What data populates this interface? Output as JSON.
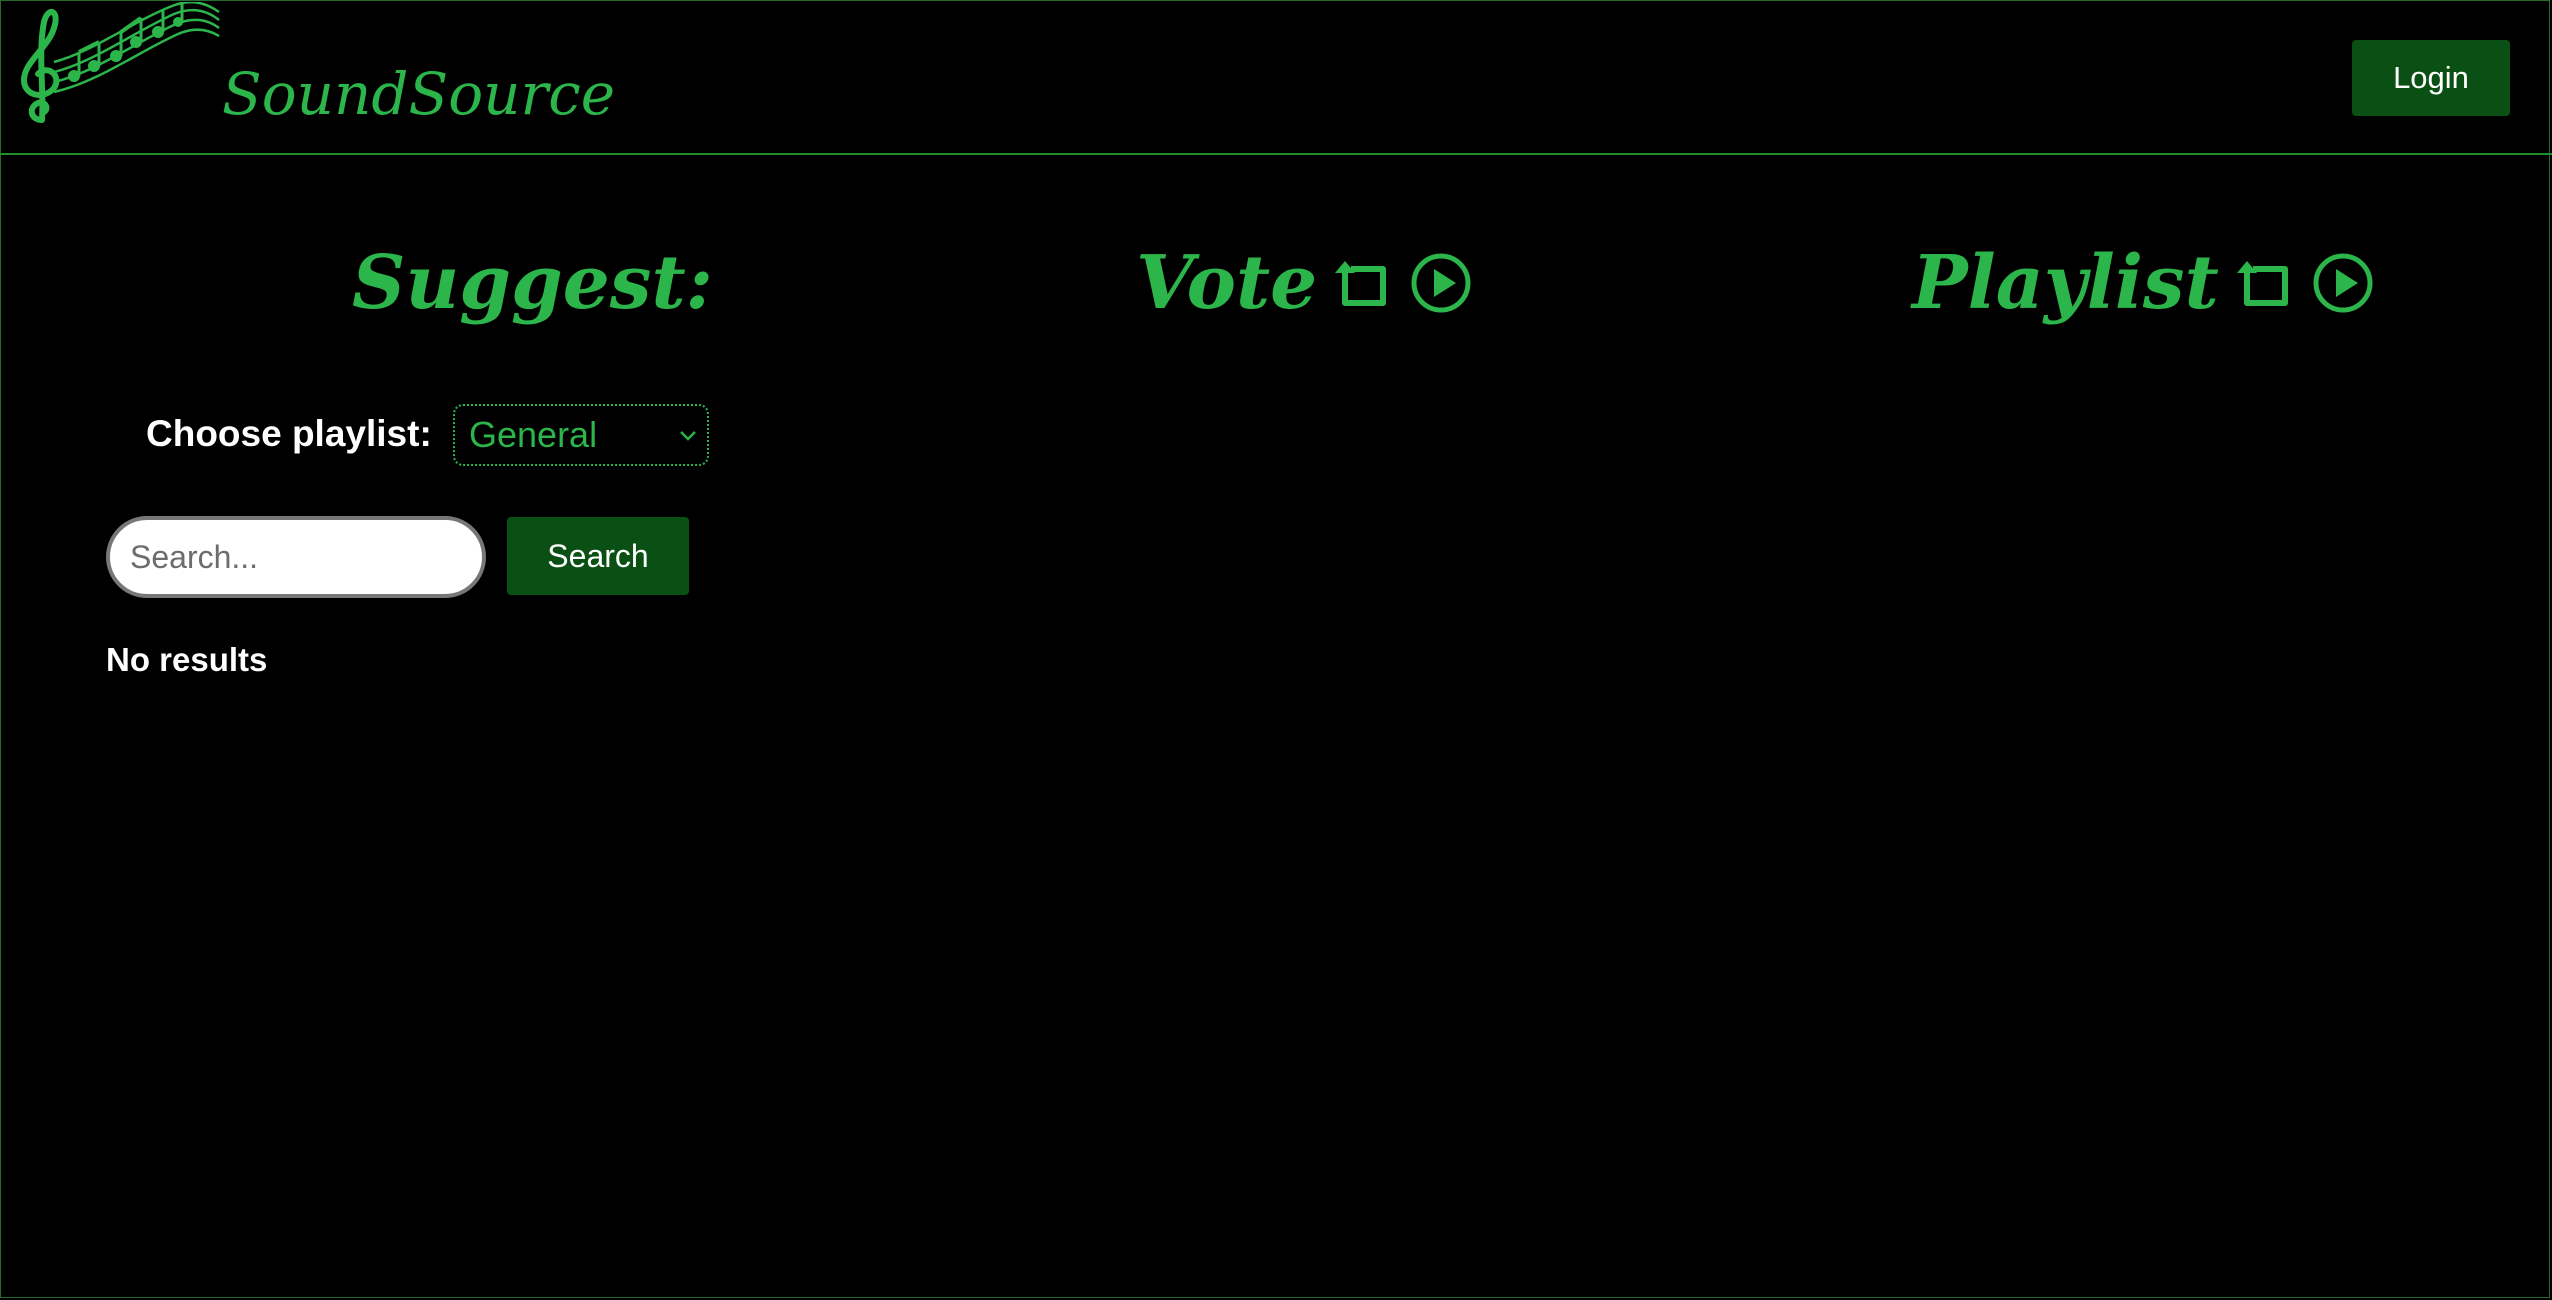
{
  "brand": {
    "name": "SoundSource",
    "logo_icon": "treble-clef-music-notes-icon"
  },
  "header": {
    "login_label": "Login"
  },
  "columns": {
    "suggest": {
      "title": "Suggest:"
    },
    "vote": {
      "title": "Vote",
      "refresh_icon": "refresh-icon",
      "play_icon": "play-icon"
    },
    "playlist": {
      "title": "Playlist",
      "refresh_icon": "refresh-icon",
      "play_icon": "play-icon"
    }
  },
  "suggest": {
    "choose_label": "Choose playlist:",
    "selected_playlist": "General",
    "search_placeholder": "Search...",
    "search_button": "Search",
    "no_results": "No results"
  },
  "colors": {
    "background": "#000000",
    "accent": "#2bb54a",
    "button": "#0a5014",
    "text": "#ffffff"
  }
}
